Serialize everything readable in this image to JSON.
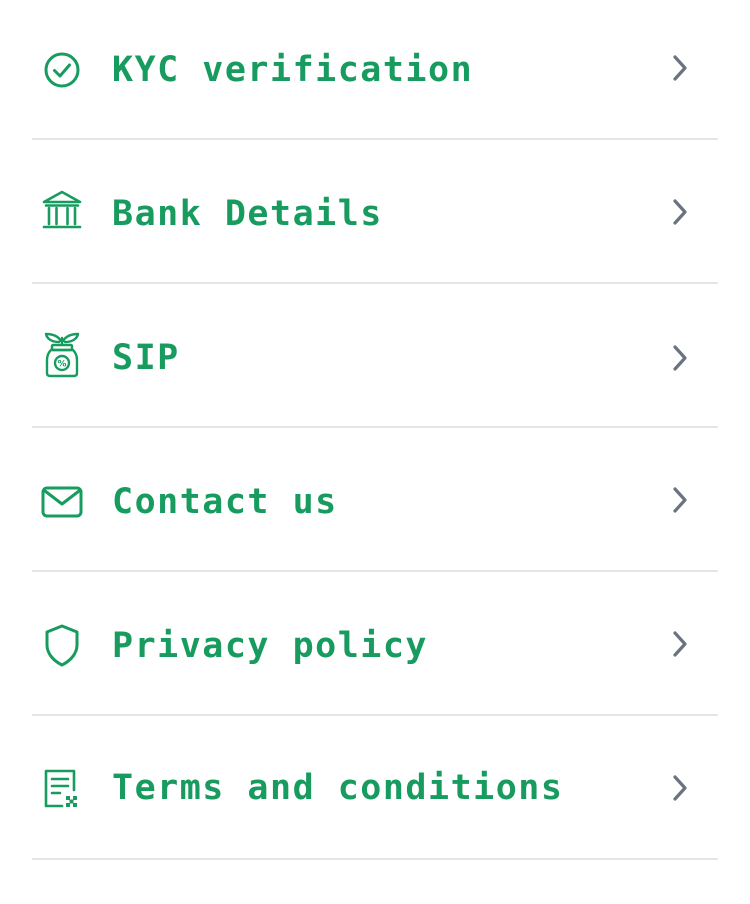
{
  "colors": {
    "accent": "#179b5f",
    "chevron": "#6b7280",
    "divider": "#e3e5e6",
    "background": "#ffffff"
  },
  "menu": {
    "items": [
      {
        "label": "KYC verification",
        "icon": "check-circle-icon"
      },
      {
        "label": "Bank Details",
        "icon": "bank-icon"
      },
      {
        "label": "SIP",
        "icon": "money-jar-plant-icon"
      },
      {
        "label": "Contact us",
        "icon": "envelope-icon"
      },
      {
        "label": "Privacy policy",
        "icon": "shield-icon"
      },
      {
        "label": "Terms and conditions",
        "icon": "document-list-icon"
      }
    ]
  }
}
